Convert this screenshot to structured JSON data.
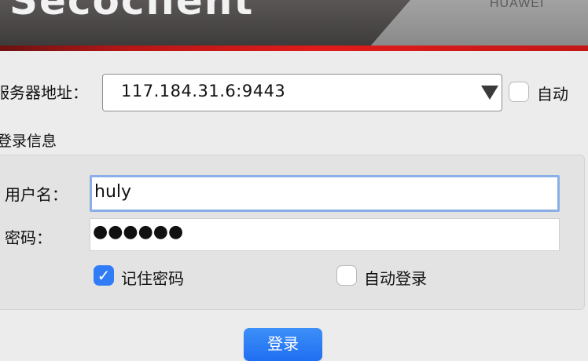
{
  "header": {
    "title": "Secoclient",
    "brand": "HUAWEI"
  },
  "server": {
    "label": "服务器地址：",
    "address": "117.184.31.6:9443",
    "auto_label": "自动",
    "auto_checked": false
  },
  "login_info": {
    "section_title": "登录信息",
    "username_label": "用户名：",
    "username_value": "huly",
    "password_label": "密码：",
    "password_masked": "●●●●●●",
    "remember_label": "记住密码",
    "remember_checked": true,
    "auto_login_label": "自动登录",
    "auto_login_checked": false
  },
  "actions": {
    "login_label": "登录"
  },
  "colors": {
    "accent_blue": "#2f7cf6",
    "banner_red": "#e11b1b",
    "focus_ring": "#8aaee8"
  }
}
